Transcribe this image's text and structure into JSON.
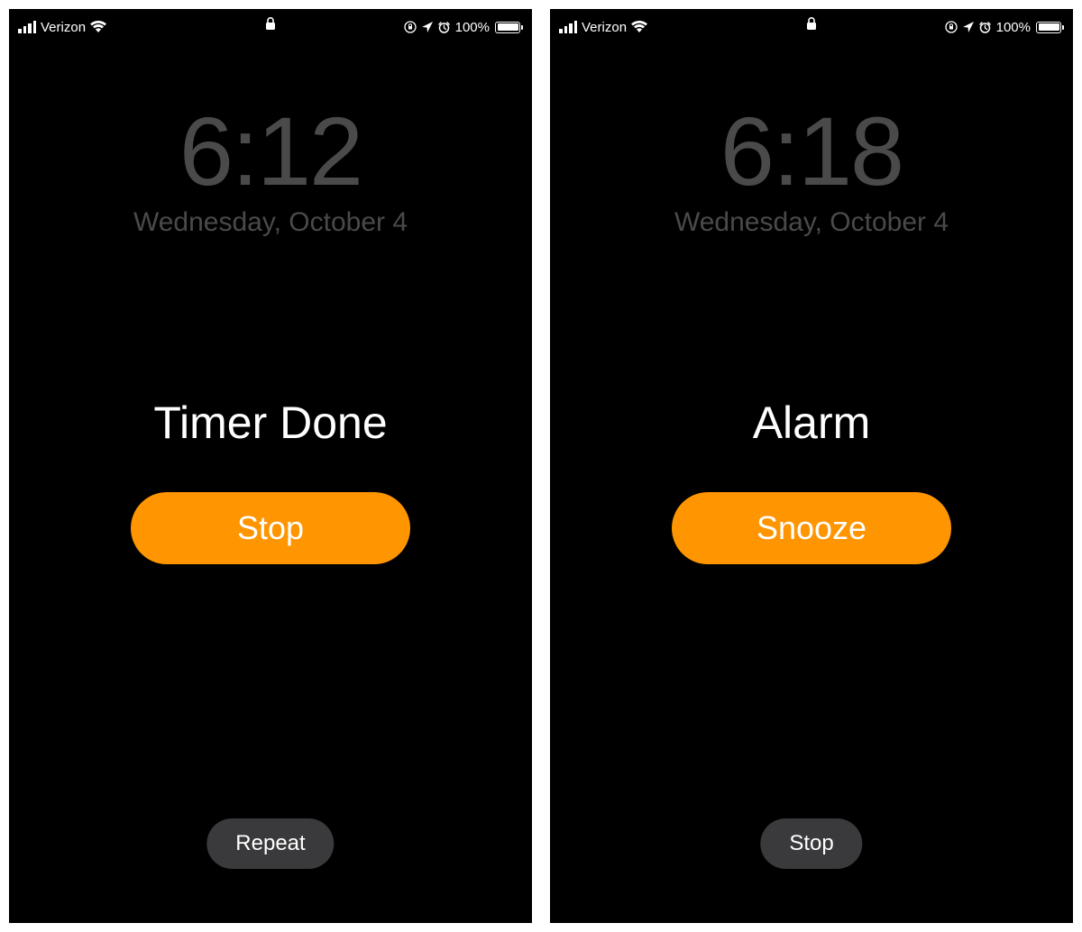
{
  "screens": [
    {
      "status": {
        "carrier": "Verizon",
        "battery_percent": "100%"
      },
      "clock": {
        "time": "6:12",
        "date": "Wednesday, October 4"
      },
      "alert": {
        "title": "Timer Done",
        "primary_button": "Stop",
        "secondary_button": "Repeat"
      }
    },
    {
      "status": {
        "carrier": "Verizon",
        "battery_percent": "100%"
      },
      "clock": {
        "time": "6:18",
        "date": "Wednesday, October 4"
      },
      "alert": {
        "title": "Alarm",
        "primary_button": "Snooze",
        "secondary_button": "Stop"
      }
    }
  ]
}
